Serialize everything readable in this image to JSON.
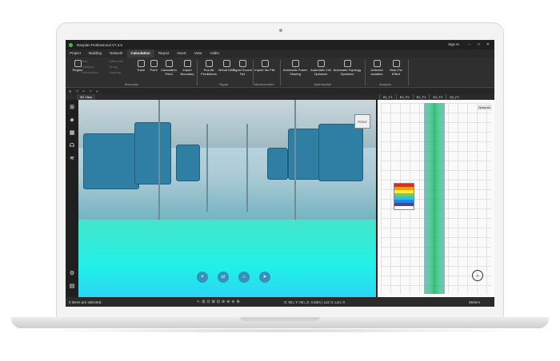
{
  "app": {
    "title": "Ranplan Professional V7.4.0",
    "sign_in": "Sign In",
    "window_controls": [
      "–",
      "□",
      "✕"
    ]
  },
  "menu": [
    "Project",
    "Building",
    "Network",
    "Calculation",
    "Report",
    "Insert",
    "View",
    "AddIn"
  ],
  "menu_active": "Calculation",
  "ribbon": {
    "buttons": [
      {
        "label": "Region",
        "enabled": true
      },
      {
        "label": "Add",
        "enabled": false
      },
      {
        "label": "Subtract",
        "enabled": false
      },
      {
        "label": "Intersection",
        "enabled": false
      },
      {
        "label": "Difference",
        "enabled": false
      },
      {
        "label": "Group",
        "enabled": false
      },
      {
        "label": "Ungroup",
        "enabled": false
      },
      {
        "label": "Trace",
        "enabled": true
      },
      {
        "label": "Point",
        "enabled": true
      },
      {
        "label": "Calculation Point",
        "enabled": true
      },
      {
        "label": "Import Boundary",
        "enabled": true
      },
      {
        "label": "Run All Predictions",
        "enabled": true
      },
      {
        "label": "Virtual DAS",
        "enabled": true
      },
      {
        "label": "Signal Source Set",
        "enabled": true
      },
      {
        "label": "Import Ibo File",
        "enabled": true
      },
      {
        "label": "Automatic Power Sharing",
        "enabled": true
      },
      {
        "label": "Automatic Cell Optimizer",
        "enabled": true
      },
      {
        "label": "Automatic Topology Optimizer",
        "enabled": true
      },
      {
        "label": "Antenna Isolation",
        "enabled": true
      },
      {
        "label": "Near-Far Effect",
        "enabled": true
      }
    ],
    "groups": [
      "Boundary",
      "Signal",
      "Measurement",
      "Optimisation",
      "Analysis"
    ]
  },
  "view_tab": "3D View",
  "floor_tabs": [
    "B1_F1",
    "B2_F5",
    "B2_F4",
    "B2_F3",
    "B2_F2"
  ],
  "view3d": {
    "cube_label": "FRONT"
  },
  "sidebar_icons": [
    "network-icon",
    "layers-icon",
    "hatch-icon",
    "antenna-icon",
    "signal-icon",
    "settings-icon",
    "report-icon"
  ],
  "plan": {
    "title": "Network"
  },
  "status": {
    "selection": "0 items are selected.",
    "coords": "X: 0m, Y: 0m, Z: 4.63m | Lat: 0, Lon: 0",
    "units": "Meters"
  },
  "colors": {
    "accent": "#4caf50",
    "coverage_high": "#21f0e8",
    "seat": "#2e7fa3"
  }
}
